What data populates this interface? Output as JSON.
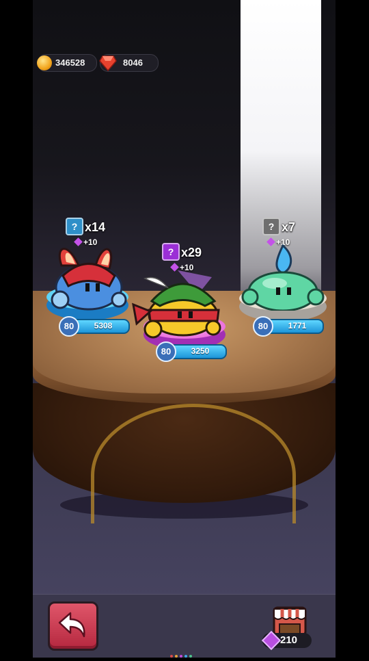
{
  "currency": {
    "coins": "346528",
    "gems": "8046",
    "coin_icon": "gold-coin-icon",
    "gem_icon": "red-gem-icon"
  },
  "slimes": [
    {
      "name_icon": "knight-slime",
      "badge_icon": "question-mark-icon",
      "badge_color": "#2f8fc8",
      "count": "x14",
      "bonus": "+10",
      "level": "80",
      "power": "5308"
    },
    {
      "name_icon": "archer-slime",
      "badge_icon": "question-mark-icon",
      "badge_color": "#9b2fd6",
      "count": "x29",
      "bonus": "+10",
      "level": "80",
      "power": "3250"
    },
    {
      "name_icon": "water-slime",
      "badge_icon": "question-mark-icon",
      "badge_color": "#6e6e6e",
      "count": "x7",
      "bonus": "+10",
      "level": "80",
      "power": "1771"
    }
  ],
  "bottom": {
    "back_icon": "back-arrow-icon",
    "shop_icon": "shop-stall-icon",
    "shop_cost": "210",
    "shop_cost_icon": "purple-gem-icon"
  },
  "colors": {
    "gold_accent": "#f2a41c",
    "level_bar": "#36b7f0",
    "back_button": "#d04259"
  }
}
